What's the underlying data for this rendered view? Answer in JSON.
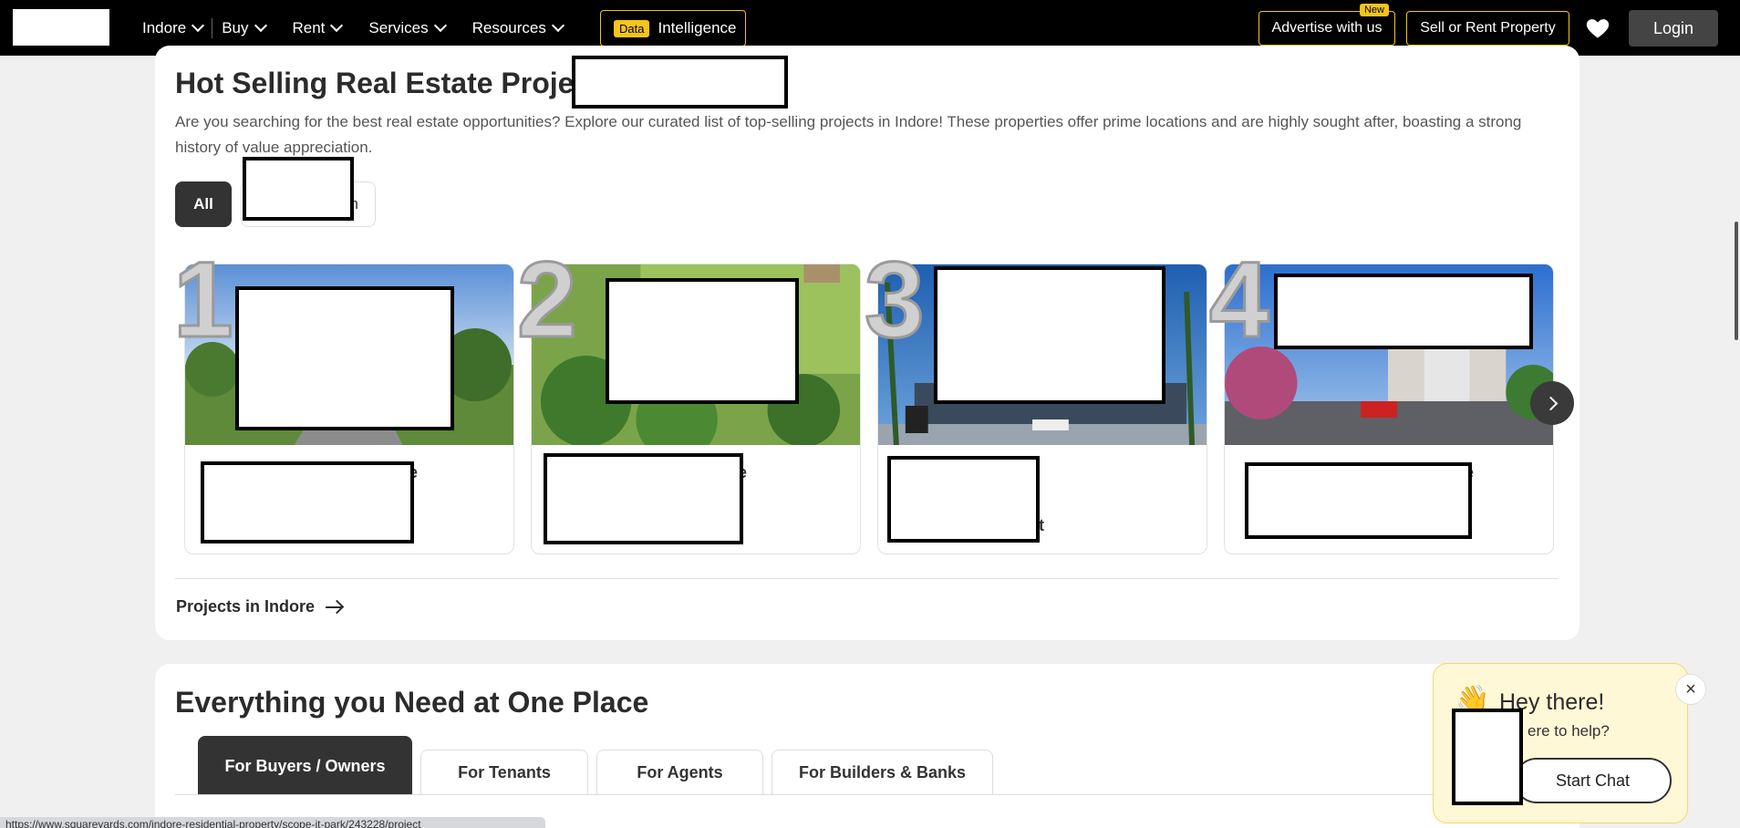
{
  "nav": {
    "links": [
      {
        "label": "Indore"
      },
      {
        "label": "Buy"
      },
      {
        "label": "Rent"
      },
      {
        "label": "Services"
      },
      {
        "label": "Resources"
      }
    ],
    "data_tag": "Data",
    "data_label": "Intelligence",
    "advertise": "Advertise with us",
    "new_badge": "New",
    "sell_rent": "Sell or Rent Property",
    "login": "Login"
  },
  "hot": {
    "title": "Hot Selling Real Estate Proje",
    "description": "Are you searching for the best real estate opportunities? Explore our curated list of top-selling projects in Indore! These properties offer prime locations and are highly sought after, boasting a strong history of value appreciation.",
    "filter_all": "All",
    "filter_two_tail": "n",
    "ranks": [
      "1",
      "2",
      "3",
      "4"
    ],
    "card_fragments": [
      "e",
      "e",
      "t",
      "e"
    ],
    "projects_link": "Projects in Indore"
  },
  "everything": {
    "title": "Everything you Need at One Place",
    "tabs": [
      "For Buyers / Owners",
      "For Tenants",
      "For Agents",
      "For Builders & Banks"
    ]
  },
  "chat": {
    "title": "Hey there!",
    "subtitle": "ere to help?",
    "close": "×",
    "button": "Start Chat"
  },
  "status_url": "https://www.squareyards.com/indore-residential-property/scope-it-park/243228/project",
  "colors": {
    "accent": "#f5c518",
    "dark": "#333333",
    "chat_bg": "#fff8d6"
  }
}
